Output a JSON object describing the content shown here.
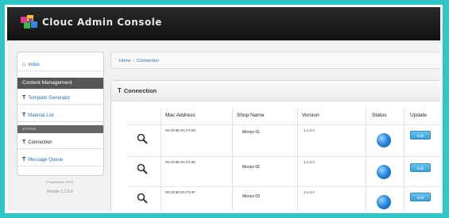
{
  "app": {
    "title": "Clouc Admin Console"
  },
  "sidebar": {
    "items": [
      {
        "label": "Index",
        "icon": "home-icon"
      },
      {
        "label": "Content Management",
        "type": "header"
      },
      {
        "label": "Template Generator",
        "icon": "text-icon"
      },
      {
        "label": "Material List",
        "icon": "text-icon"
      }
    ],
    "section_label": "STATUS",
    "status_items": [
      {
        "label": "Connection",
        "icon": "text-icon"
      },
      {
        "label": "Message Queue",
        "icon": "text-icon"
      }
    ],
    "footer_copyright": "© topdomain. 2015",
    "footer_version": "Version 1.1.0.0"
  },
  "breadcrumb": {
    "home": "Home",
    "separator": "/",
    "current": "Connection"
  },
  "panel": {
    "title": "Connection",
    "columns": [
      "Mac Address",
      "Shop Name",
      "Version",
      "Status",
      "Update"
    ],
    "rows": [
      {
        "mac": "00:20:9E:8A:F0:0D",
        "shop": "Monyo 01",
        "version": "1.1.0.0",
        "action": "Edit"
      },
      {
        "mac": "00:20:9E:8A:F0:0E",
        "shop": "Monyo 02",
        "version": "1.1.0.0",
        "action": "Edit"
      },
      {
        "mac": "00:20:9E:8A:F0:0F",
        "shop": "Monyo 03",
        "version": "1.1.0.0",
        "action": "Edit"
      }
    ]
  },
  "colors": {
    "accent": "#2fc6c8",
    "link": "#2a6fb3",
    "button": "#3a9fd8"
  }
}
